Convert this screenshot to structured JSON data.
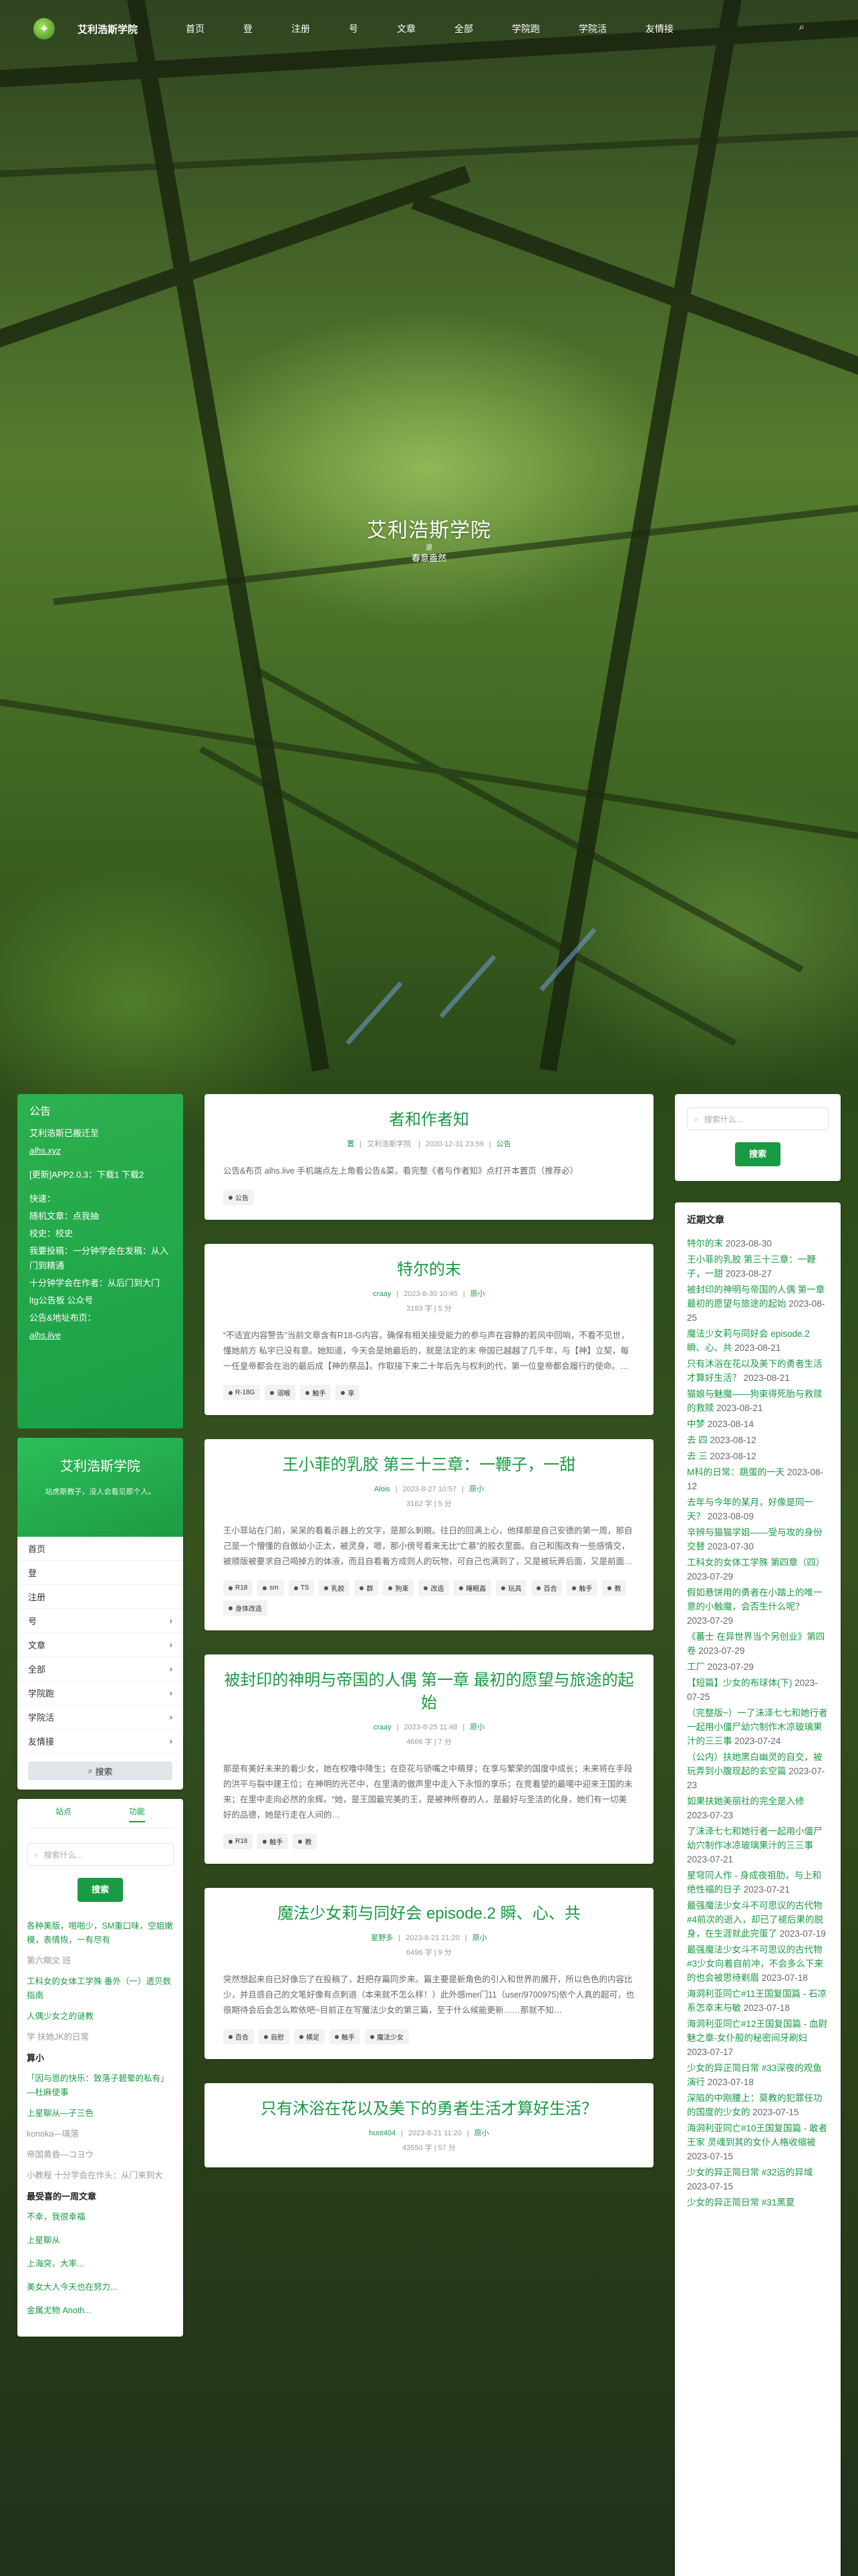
{
  "nav": {
    "brand": "艾利浩斯学院 ",
    "items": [
      "首页",
      "登",
      "注册",
      "号",
      "文章",
      "全部",
      "学院跑",
      "学院活",
      "友情接"
    ]
  },
  "hero": {
    "title": "艾利浩斯学院 ",
    "small": "退",
    "subtitle": "春意盎然"
  },
  "notice": {
    "title": "公告",
    "lines": [
      "艾利浩斯已搬迁至",
      "alhs.xyz",
      "[更新]APP2.0.3：下载1 下载2",
      "快速：",
      "随机文章：点我抽",
      "校史：校史",
      "我要投稿：一分钟学会在发稿：从入门到精通",
      "十分钟学会在作者：从后门到大门",
      "ltg公告板 公众号",
      "公告&地址布页：",
      "alhs.live"
    ]
  },
  "profile": {
    "name": "艾利浩斯学院 ",
    "desc": "站虎斯教子，没人会看见那个人。",
    "menu": [
      {
        "label": "首页",
        "arrow": ""
      },
      {
        "label": "登",
        "arrow": ""
      },
      {
        "label": "注册",
        "arrow": ""
      },
      {
        "label": "号",
        "arrow": "›"
      },
      {
        "label": "文章",
        "arrow": "›"
      },
      {
        "label": "全部",
        "arrow": "›"
      },
      {
        "label": "学院跑",
        "arrow": "›"
      },
      {
        "label": "学院活",
        "arrow": "›"
      },
      {
        "label": "友情接",
        "arrow": "›"
      }
    ],
    "search_btn": "搜索"
  },
  "left_tabs": {
    "tab1": "站点",
    "tab2": "功能",
    "placeholder": "搜索什么...",
    "button": "搜索",
    "recommend": [
      {
        "text": "各种美版，啪啪少，SM重口味，空姐嫩模，表情恢，一有尽有",
        "green": true
      },
      {
        "text": "第六期文 班",
        "green": false
      },
      {
        "text": "工科女的女体工学殊 番外（一）遗贝数指南",
        "green": true
      },
      {
        "text": "人偶少女之的谜教",
        "green": true
      },
      {
        "text": "学 扶她JK的日常",
        "green": false
      }
    ],
    "section1": "算小",
    "section1_items": [
      "「因与恩的快乐：致落子碧晕的私有」—杜麻使事",
      "上星聊从—子三色",
      "konoka—璃落",
      "帝国黄昏—コヨウ",
      "小教程 十分学会在作头：从门来到大"
    ],
    "section2": "最受喜的一周文章",
    "section2_items": [
      {
        "text": "不幸，我很幸福",
        "count": ""
      },
      {
        "text": "上星聊从",
        "count": ""
      },
      {
        "text": "上海突，大率...",
        "count": ""
      },
      {
        "text": "美女大人今天也在努力...",
        "count": ""
      },
      {
        "text": "金属尤物 Anoth...",
        "count": ""
      }
    ]
  },
  "posts": [
    {
      "title": "者和作者知",
      "meta": [
        "置",
        "艾利浩斯学院 ",
        "2020-12-31 23:59",
        "公告"
      ],
      "meta2": "",
      "excerpt": "公告&布页 alhs.live 手机端点左上角看公告&菜，看完整《者与作者知》点打开本置页（推荐必）",
      "tags": [
        "公告"
      ]
    },
    {
      "title": "特尔的末",
      "meta": [
        "craay",
        "2023-8-30 10:45",
        "原小"
      ],
      "meta2": "3193 字 | 5 分",
      "excerpt": "“不适宜内容警告”当前文章含有R18-G内容，确保有相关接受能力的参与声在容静的若风中回响，不看不见世，懂她前方 私宇已没有意。她知道，今天会是她最后的，就是法定的末 帝国已越越了几千年，与【神】立契，每一任皇帝都会在治的最后成【神的祭品】。作取接下来二十年后先与权利的代，第一位皇帝都会履行的使命。…",
      "tags": [
        "R-18G",
        "溺喉",
        "触手",
        "享"
      ]
    },
    {
      "title": "王小菲的乳胶 第三十三章：一鞭子，一甜",
      "meta": [
        "Alois",
        "2023-8-27 10:57",
        "原小"
      ],
      "meta2": "3162 字 | 5 分",
      "excerpt": "王小菲站在门前，呆呆的看着示器上的文字，是那么刺眼。往日的回满上心，他择那是自己安德的第一周，那自己是一个懵懂的自傲幼小正太，被灵身，嗯，那小傍号看来无比“亡慕”的胶衣里面。自己和围改有一些感情交，被顺版被要求自己喝掉方的体液，而且自看着方成则人的玩物，可自己也满到了，又是被玩弄后面，又是前面…",
      "tags": [
        "R18",
        "sm",
        "TS",
        "乳胶",
        "群",
        "狗束",
        "改造",
        "睡眠姦",
        "玩具",
        "百合",
        "触手",
        "教",
        "身体改造"
      ]
    },
    {
      "title": "被封印的神明与帝国的人偶 第一章 最初的愿望与旅途的起始",
      "meta": [
        "craay",
        "2023-8-25 11:48",
        "原小"
      ],
      "meta2": "4666 字 | 7 分",
      "excerpt": "那是有美好未来的着少女，她在权噜中降生；在臣花与骄嘴之中萌芽；在享与繁荣的国度中成长；未来将在手段的洪平与裂中建王位；在神明的光芒中，在里清的傲声里中走入下永恒的享乐；在竞着望的最噶中迎来王国的未来；在里中走向必然的余辉。“她，是王国最完美的王，是被神所眷的人，是最好与圣洁的化身，她们有一切美好的品德，她是行走在人间的…",
      "tags": [
        "R18",
        "触手",
        "教"
      ]
    },
    {
      "title": "魔法少女莉与同好会 episode.2 瞬、心、共",
      "meta": [
        "星野多",
        "2023-8-21 21:20",
        "原小"
      ],
      "meta2": "6496 字 | 9 分",
      "excerpt": "突然想起来自已好像忘了在投稿了，赶把存篇同步来。篇主要是新角色的引入和世界的展开，所以色色的内容比少，并且感自己的文笔好像有点刺退（本来就不怎么样！）此外感mer门11（user/9700975)依个人真的超可，也很期待会后会怎么欺依吧~目前正在写魔法少女的第三篇，至于什么候能更新……那就不知…",
      "tags": [
        "百合",
        "自慰",
        "横足",
        "触手",
        "魔法少女"
      ]
    },
    {
      "title": "只有沐浴在花以及美下的勇者生活才算好生活？",
      "meta": [
        "hunt404",
        "2023-8-21 11:20",
        "原小"
      ],
      "meta2": "43550 字 | 57 分",
      "excerpt": "",
      "tags": []
    }
  ],
  "right": {
    "placeholder": "搜索什么...",
    "button": "搜索",
    "latest_title": "近期文章",
    "latest": [
      {
        "t": "特尔的末",
        "d": "2023-08-30"
      },
      {
        "t": "王小菲的乳胶 第三十三章：一鞭子，一甜",
        "d": "2023-08-27"
      },
      {
        "t": "被封印的神明与帝国的人偶 第一章 最初的愿望与旅途的起始",
        "d": "2023-08-25"
      },
      {
        "t": "魔法少女莉与同好会 episode.2 瞬、心、共",
        "d": "2023-08-21"
      },
      {
        "t": "只有沐浴在花以及美下的勇者生活才算好生活？",
        "d": "2023-08-21"
      },
      {
        "t": "猫娘与魅魔——狗束得死胎与救赎的救赎",
        "d": "2023-08-21"
      },
      {
        "t": "中梦",
        "d": "2023-08-14"
      },
      {
        "t": "去 四",
        "d": "2023-08-12"
      },
      {
        "t": "去 三",
        "d": "2023-08-12"
      },
      {
        "t": "M科的日常：跳蛋的一天",
        "d": "2023-08-12"
      },
      {
        "t": "去年与今年的某月，好像是同一天？",
        "d": "2023-08-09"
      },
      {
        "t": "辛辨与猫猫学姐——受与攻的身份交替",
        "d": "2023-07-30"
      },
      {
        "t": "工科女的女体工学殊 第四章（四）",
        "d": "2023-07-29"
      },
      {
        "t": "假如悬饼用的勇者在小踏上的唯一意的小触魔，会否生什么呢？",
        "d": "2023-07-29"
      },
      {
        "t": "《蕃士 在异世界当个另创业》第四卷",
        "d": "2023-07-29"
      },
      {
        "t": "工厂",
        "d": "2023-07-29"
      },
      {
        "t": "【短篇】少女的布球体(下)",
        "d": "2023-07-25"
      },
      {
        "t": "（完整版~）一了沫泽七七和她行者一起用小僵尸幼穴制作木凉玻璃果汁的三三事",
        "d": "2023-07-24"
      },
      {
        "t": "（公内）扶她黑白幽灵的自交，被玩弄到小腹现起的玄空篇",
        "d": "2023-07-23"
      },
      {
        "t": "如果扶她美丽社的完全是入修",
        "d": "2023-07-23"
      },
      {
        "t": "了沫泽七七和她行者一起用小僵尸幼穴制作冰凉玻璃果汁的三三事",
        "d": "2023-07-21"
      },
      {
        "t": "星穹同人作 - 身成夜祖肋，与上和绝性福的日子",
        "d": "2023-07-21"
      },
      {
        "t": "最强魔法少女斗不可思议的古代物 #4前次的逝入，却已了褪后果的脱身，在生涯就此完蛋了",
        "d": "2023-07-19"
      },
      {
        "t": "最强魔法少女斗不可思议的古代物 #3少女向着自前冲，不会多么下来的也会被思待剃眉",
        "d": "2023-07-18"
      },
      {
        "t": "海洞利亚同亡#11王国复国篇 - 石凉系怎幸末与敏",
        "d": "2023-07-18"
      },
      {
        "t": "海洞利亚同亡#12王国复国篇 - 血尉魅之章-女仆般的秘密间牙刷妇",
        "d": "2023-07-17"
      },
      {
        "t": "少女的异正简日常 #33深夜的观鱼演行",
        "d": "2023-07-18"
      },
      {
        "t": "深陷的中刚腰上：莫教的犯罪任功的国度的少女的",
        "d": "2023-07-15"
      },
      {
        "t": "海洞利亚同亡#10王国复国篇 - 敢者王家 灵魂到其的女仆人格收缩被",
        "d": "2023-07-15"
      },
      {
        "t": "少女的异正简日常 #32远的异域",
        "d": "2023-07-15"
      },
      {
        "t": "少女的异正简日常 #31黑夏",
        "d": ""
      }
    ]
  }
}
